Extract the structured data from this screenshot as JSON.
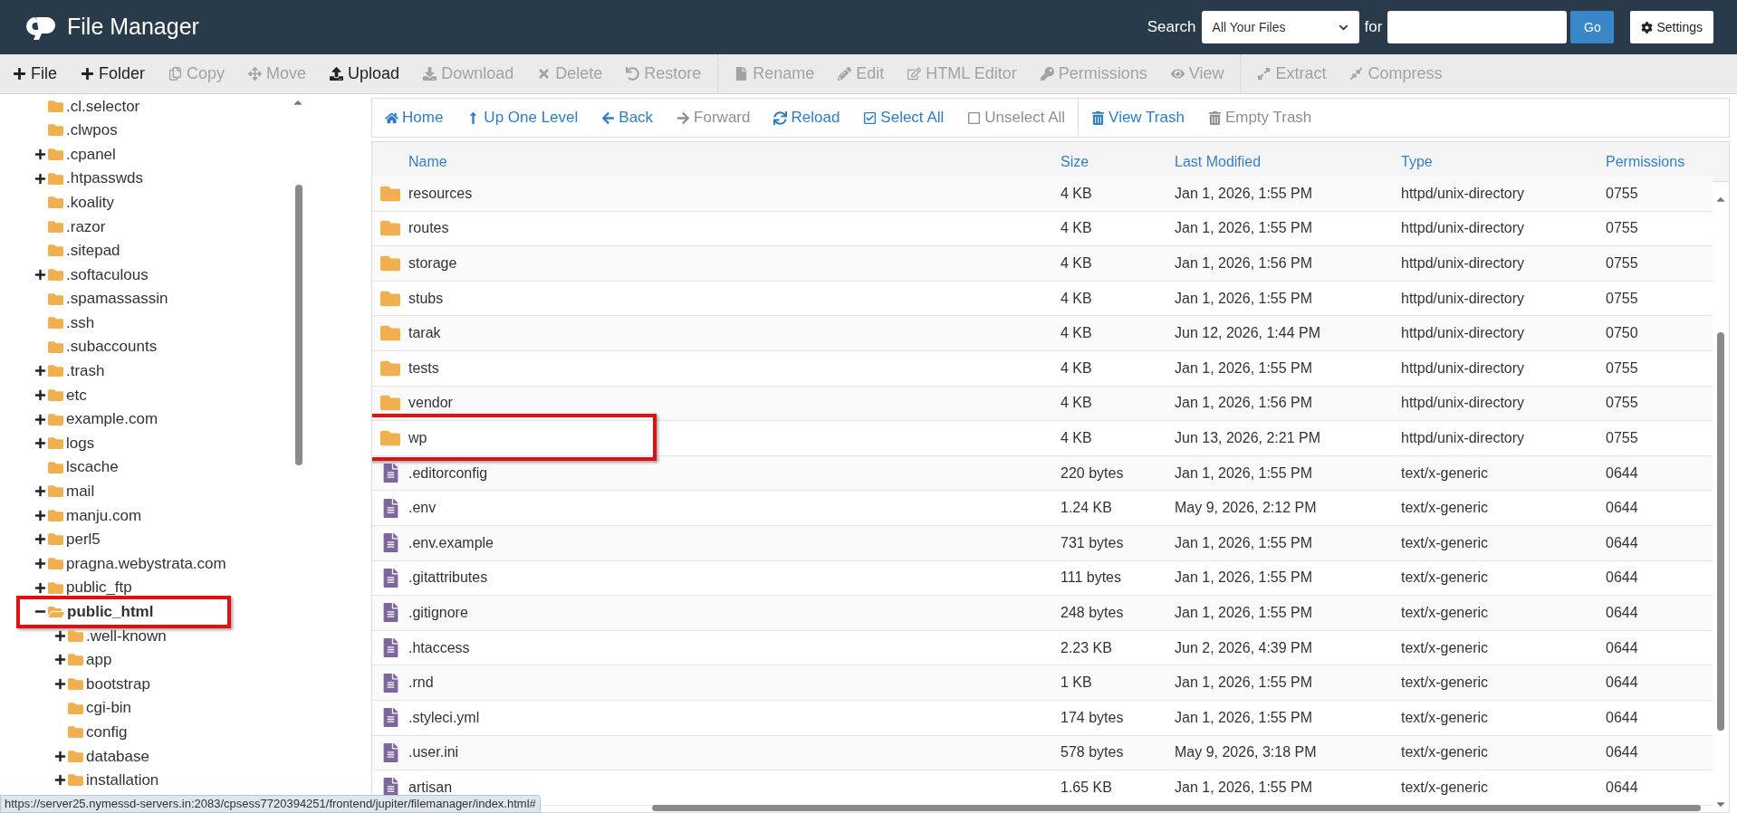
{
  "header": {
    "title": "File Manager",
    "search_label": "Search",
    "search_scope": "All Your Files",
    "for_label": "for",
    "go_button": "Go",
    "settings_button": "Settings"
  },
  "toolbar": [
    [
      {
        "label": "File",
        "disabled": false
      },
      {
        "label": "Folder",
        "disabled": false
      },
      {
        "label": "Copy",
        "disabled": true
      },
      {
        "label": "Move",
        "disabled": true
      },
      {
        "label": "Upload",
        "disabled": false
      },
      {
        "label": "Download",
        "disabled": true
      },
      {
        "label": "Delete",
        "disabled": true
      },
      {
        "label": "Restore",
        "disabled": true
      }
    ],
    [
      {
        "label": "Rename",
        "disabled": true
      },
      {
        "label": "Edit",
        "disabled": true
      },
      {
        "label": "HTML Editor",
        "disabled": true
      },
      {
        "label": "Permissions",
        "disabled": true
      },
      {
        "label": "View",
        "disabled": true
      }
    ],
    [
      {
        "label": "Extract",
        "disabled": true
      },
      {
        "label": "Compress",
        "disabled": true
      }
    ]
  ],
  "tree": [
    {
      "label": ".cl.selector",
      "has_children": false,
      "expanded": false,
      "selected": false,
      "highlighted": false
    },
    {
      "label": ".clwpos",
      "has_children": false,
      "expanded": false,
      "selected": false,
      "highlighted": false
    },
    {
      "label": ".cpanel",
      "has_children": true,
      "expanded": false,
      "selected": false,
      "highlighted": false
    },
    {
      "label": ".htpasswds",
      "has_children": true,
      "expanded": false,
      "selected": false,
      "highlighted": false
    },
    {
      "label": ".koality",
      "has_children": false,
      "expanded": false,
      "selected": false,
      "highlighted": false
    },
    {
      "label": ".razor",
      "has_children": false,
      "expanded": false,
      "selected": false,
      "highlighted": false
    },
    {
      "label": ".sitepad",
      "has_children": false,
      "expanded": false,
      "selected": false,
      "highlighted": false
    },
    {
      "label": ".softaculous",
      "has_children": true,
      "expanded": false,
      "selected": false,
      "highlighted": false
    },
    {
      "label": ".spamassassin",
      "has_children": false,
      "expanded": false,
      "selected": false,
      "highlighted": false
    },
    {
      "label": ".ssh",
      "has_children": false,
      "expanded": false,
      "selected": false,
      "highlighted": false
    },
    {
      "label": ".subaccounts",
      "has_children": false,
      "expanded": false,
      "selected": false,
      "highlighted": false
    },
    {
      "label": ".trash",
      "has_children": true,
      "expanded": false,
      "selected": false,
      "highlighted": false
    },
    {
      "label": "etc",
      "has_children": true,
      "expanded": false,
      "selected": false,
      "highlighted": false
    },
    {
      "label": "example.com",
      "has_children": true,
      "expanded": false,
      "selected": false,
      "highlighted": false
    },
    {
      "label": "logs",
      "has_children": true,
      "expanded": false,
      "selected": false,
      "highlighted": false
    },
    {
      "label": "lscache",
      "has_children": false,
      "expanded": false,
      "selected": false,
      "highlighted": false
    },
    {
      "label": "mail",
      "has_children": true,
      "expanded": false,
      "selected": false,
      "highlighted": false
    },
    {
      "label": "manju.com",
      "has_children": true,
      "expanded": false,
      "selected": false,
      "highlighted": false
    },
    {
      "label": "perl5",
      "has_children": true,
      "expanded": false,
      "selected": false,
      "highlighted": false
    },
    {
      "label": "pragna.webystrata.com",
      "has_children": true,
      "expanded": false,
      "selected": false,
      "highlighted": false
    },
    {
      "label": "public_ftp",
      "has_children": true,
      "expanded": false,
      "selected": false,
      "highlighted": false
    },
    {
      "label": "public_html",
      "has_children": true,
      "expanded": true,
      "selected": true,
      "highlighted": true,
      "children": [
        {
          "label": ".well-known",
          "has_children": true,
          "expanded": false,
          "selected": false,
          "highlighted": false
        },
        {
          "label": "app",
          "has_children": true,
          "expanded": false,
          "selected": false,
          "highlighted": false
        },
        {
          "label": "bootstrap",
          "has_children": true,
          "expanded": false,
          "selected": false,
          "highlighted": false
        },
        {
          "label": "cgi-bin",
          "has_children": false,
          "expanded": false,
          "selected": false,
          "highlighted": false
        },
        {
          "label": "config",
          "has_children": false,
          "expanded": false,
          "selected": false,
          "highlighted": false
        },
        {
          "label": "database",
          "has_children": true,
          "expanded": false,
          "selected": false,
          "highlighted": false
        },
        {
          "label": "installation",
          "has_children": true,
          "expanded": false,
          "selected": false,
          "highlighted": false
        }
      ]
    }
  ],
  "nav": [
    [
      {
        "label": "Home",
        "disabled": false
      },
      {
        "label": "Up One Level",
        "disabled": false
      },
      {
        "label": "Back",
        "disabled": false
      },
      {
        "label": "Forward",
        "disabled": true
      },
      {
        "label": "Reload",
        "disabled": false
      },
      {
        "label": "Select All",
        "disabled": false
      },
      {
        "label": "Unselect All",
        "disabled": true
      }
    ],
    [
      {
        "label": "View Trash",
        "disabled": false
      },
      {
        "label": "Empty Trash",
        "disabled": true
      }
    ]
  ],
  "table": {
    "columns": [
      "Name",
      "Size",
      "Last Modified",
      "Type",
      "Permissions"
    ],
    "rows": [
      {
        "kind": "folder",
        "name": "resources",
        "size": "4 KB",
        "modified": "Jan 1, 2026, 1:55 PM",
        "type": "httpd/unix-directory",
        "permissions": "0755",
        "highlighted": false
      },
      {
        "kind": "folder",
        "name": "routes",
        "size": "4 KB",
        "modified": "Jan 1, 2026, 1:55 PM",
        "type": "httpd/unix-directory",
        "permissions": "0755",
        "highlighted": false
      },
      {
        "kind": "folder",
        "name": "storage",
        "size": "4 KB",
        "modified": "Jan 1, 2026, 1:56 PM",
        "type": "httpd/unix-directory",
        "permissions": "0755",
        "highlighted": false
      },
      {
        "kind": "folder",
        "name": "stubs",
        "size": "4 KB",
        "modified": "Jan 1, 2026, 1:55 PM",
        "type": "httpd/unix-directory",
        "permissions": "0755",
        "highlighted": false
      },
      {
        "kind": "folder",
        "name": "tarak",
        "size": "4 KB",
        "modified": "Jun 12, 2026, 1:44 PM",
        "type": "httpd/unix-directory",
        "permissions": "0750",
        "highlighted": false
      },
      {
        "kind": "folder",
        "name": "tests",
        "size": "4 KB",
        "modified": "Jan 1, 2026, 1:55 PM",
        "type": "httpd/unix-directory",
        "permissions": "0755",
        "highlighted": false
      },
      {
        "kind": "folder",
        "name": "vendor",
        "size": "4 KB",
        "modified": "Jan 1, 2026, 1:56 PM",
        "type": "httpd/unix-directory",
        "permissions": "0755",
        "highlighted": false
      },
      {
        "kind": "folder",
        "name": "wp",
        "size": "4 KB",
        "modified": "Jun 13, 2026, 2:21 PM",
        "type": "httpd/unix-directory",
        "permissions": "0755",
        "highlighted": true
      },
      {
        "kind": "file",
        "name": ".editorconfig",
        "size": "220 bytes",
        "modified": "Jan 1, 2026, 1:55 PM",
        "type": "text/x-generic",
        "permissions": "0644",
        "highlighted": false
      },
      {
        "kind": "file",
        "name": ".env",
        "size": "1.24 KB",
        "modified": "May 9, 2026, 2:12 PM",
        "type": "text/x-generic",
        "permissions": "0644",
        "highlighted": false
      },
      {
        "kind": "file",
        "name": ".env.example",
        "size": "731 bytes",
        "modified": "Jan 1, 2026, 1:55 PM",
        "type": "text/x-generic",
        "permissions": "0644",
        "highlighted": false
      },
      {
        "kind": "file",
        "name": ".gitattributes",
        "size": "111 bytes",
        "modified": "Jan 1, 2026, 1:55 PM",
        "type": "text/x-generic",
        "permissions": "0644",
        "highlighted": false
      },
      {
        "kind": "file",
        "name": ".gitignore",
        "size": "248 bytes",
        "modified": "Jan 1, 2026, 1:55 PM",
        "type": "text/x-generic",
        "permissions": "0644",
        "highlighted": false
      },
      {
        "kind": "file",
        "name": ".htaccess",
        "size": "2.23 KB",
        "modified": "Jun 2, 2026, 4:39 PM",
        "type": "text/x-generic",
        "permissions": "0644",
        "highlighted": false
      },
      {
        "kind": "file",
        "name": ".rnd",
        "size": "1 KB",
        "modified": "Jan 1, 2026, 1:55 PM",
        "type": "text/x-generic",
        "permissions": "0644",
        "highlighted": false
      },
      {
        "kind": "file",
        "name": ".styleci.yml",
        "size": "174 bytes",
        "modified": "Jan 1, 2026, 1:55 PM",
        "type": "text/x-generic",
        "permissions": "0644",
        "highlighted": false
      },
      {
        "kind": "file",
        "name": ".user.ini",
        "size": "578 bytes",
        "modified": "May 9, 2026, 3:18 PM",
        "type": "text/x-generic",
        "permissions": "0644",
        "highlighted": false
      },
      {
        "kind": "file",
        "name": "artisan",
        "size": "1.65 KB",
        "modified": "Jan 1, 2026, 1:55 PM",
        "type": "text/x-generic",
        "permissions": "0644",
        "highlighted": false
      }
    ]
  },
  "status_url": "https://server25.nymessd-servers.in:2083/cpsess7720394251/frontend/jupiter/filemanager/index.html#"
}
